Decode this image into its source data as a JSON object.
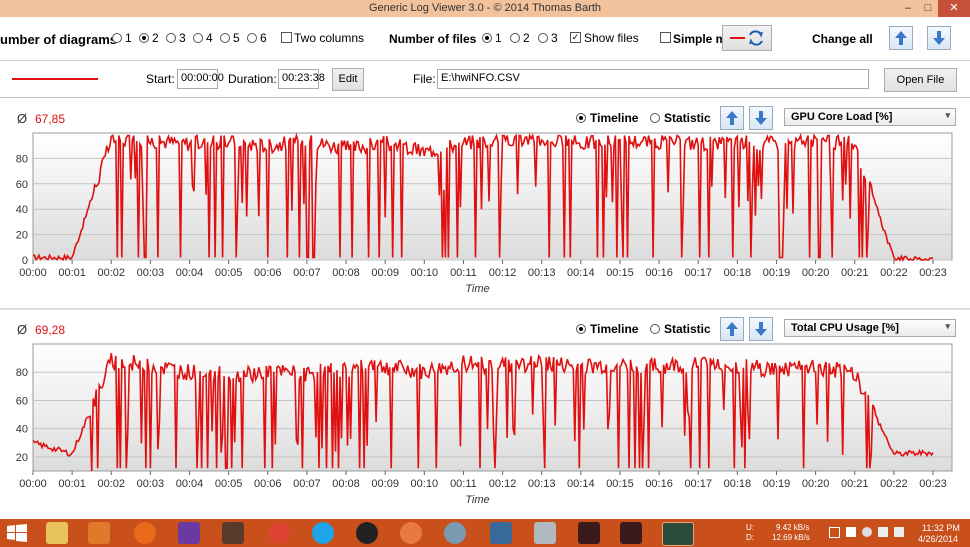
{
  "window": {
    "title": "Generic Log Viewer 3.0 - © 2014 Thomas Barth",
    "minimize": "–",
    "maximize": "□",
    "close": "✕"
  },
  "toolbar": {
    "num_diagrams_label": "umber of diagrams",
    "diagram_options": [
      "1",
      "2",
      "3",
      "4",
      "5",
      "6"
    ],
    "diagram_selected": "2",
    "two_columns_label": "Two columns",
    "num_files_label": "Number of files",
    "file_options": [
      "1",
      "2",
      "3"
    ],
    "file_selected": "1",
    "show_files_label": "Show files",
    "show_files_checked": true,
    "simple_mode_label": "Simple m",
    "change_all_label": "Change all"
  },
  "file_row": {
    "start_label": "Start:",
    "start_value": "00:00:00",
    "duration_label": "Duration:",
    "duration_value": "00:23:38",
    "edit_button": "Edit",
    "file_label": "File:",
    "file_path": "E:\\hwiNFO.CSV",
    "open_file_button": "Open File",
    "line_color": "#e01010"
  },
  "panels": [
    {
      "avg_symbol": "Ø",
      "avg_value": "67,85",
      "timeline_label": "Timeline",
      "statistic_label": "Statistic",
      "sensor": "GPU Core Load [%]"
    },
    {
      "avg_symbol": "Ø",
      "avg_value": "69,28",
      "timeline_label": "Timeline",
      "statistic_label": "Statistic",
      "sensor": "Total CPU Usage [%]"
    }
  ],
  "chart_data": [
    {
      "type": "line",
      "series": [
        {
          "color": "#e01010",
          "x": [
            "00:00",
            "00:01",
            "00:02",
            "00:03",
            "00:04",
            "00:05",
            "00:06",
            "00:07",
            "00:08",
            "00:09",
            "00:10",
            "00:11",
            "00:12",
            "00:13",
            "00:14",
            "00:15",
            "00:16",
            "00:17",
            "00:18",
            "00:19",
            "00:20",
            "00:21",
            "00:22",
            "00:23"
          ],
          "values": [
            2,
            2,
            95,
            94,
            92,
            93,
            90,
            94,
            88,
            92,
            85,
            92,
            96,
            95,
            92,
            94,
            93,
            92,
            93,
            92,
            94,
            92,
            1,
            1
          ]
        }
      ],
      "xlabel": "Time",
      "ylabel": "",
      "ylim": [
        0,
        100
      ],
      "yticks": [
        0,
        20,
        40,
        60,
        80
      ],
      "xticks": [
        "00:00",
        "00:01",
        "00:02",
        "00:03",
        "00:04",
        "00:05",
        "00:06",
        "00:07",
        "00:08",
        "00:09",
        "00:10",
        "00:11",
        "00:12",
        "00:13",
        "00:14",
        "00:15",
        "00:16",
        "00:17",
        "00:18",
        "00:19",
        "00:20",
        "00:21",
        "00:22",
        "00:23"
      ],
      "grid": true
    },
    {
      "type": "line",
      "series": [
        {
          "color": "#e01010",
          "x": [
            "00:00",
            "00:01",
            "00:02",
            "00:03",
            "00:04",
            "00:05",
            "00:06",
            "00:07",
            "00:08",
            "00:09",
            "00:10",
            "00:11",
            "00:12",
            "00:13",
            "00:14",
            "00:15",
            "00:16",
            "00:17",
            "00:18",
            "00:19",
            "00:20",
            "00:21",
            "00:22",
            "00:23"
          ],
          "values": [
            30,
            22,
            88,
            85,
            80,
            78,
            80,
            79,
            82,
            84,
            80,
            86,
            85,
            86,
            84,
            85,
            84,
            86,
            84,
            82,
            83,
            80,
            22,
            23
          ]
        }
      ],
      "xlabel": "Time",
      "ylabel": "",
      "ylim": [
        10,
        100
      ],
      "yticks": [
        20,
        40,
        60,
        80
      ],
      "xticks": [
        "00:00",
        "00:01",
        "00:02",
        "00:03",
        "00:04",
        "00:05",
        "00:06",
        "00:07",
        "00:08",
        "00:09",
        "00:10",
        "00:11",
        "00:12",
        "00:13",
        "00:14",
        "00:15",
        "00:16",
        "00:17",
        "00:18",
        "00:19",
        "00:20",
        "00:21",
        "00:22",
        "00:23"
      ],
      "grid": true
    }
  ],
  "taskbar": {
    "upload": "U:",
    "download": "D:",
    "up_rate": "9.42 kB/s",
    "down_rate": "12.69 kB/s",
    "time": "11:32 PM",
    "date": "4/26/2014"
  }
}
